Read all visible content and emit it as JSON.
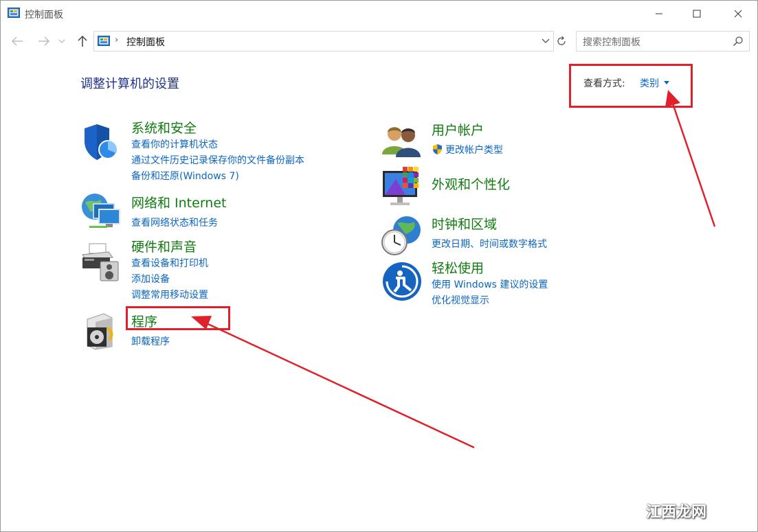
{
  "window": {
    "title": "控制面板"
  },
  "address": {
    "path": "控制面板",
    "separator": "›"
  },
  "search": {
    "placeholder": "搜索控制面板"
  },
  "main": {
    "heading": "调整计算机的设置",
    "view_by_label": "查看方式:",
    "view_by_value": "类别"
  },
  "categories": [
    {
      "title": "系统和安全",
      "links": [
        "查看你的计算机状态",
        "通过文件历史记录保存你的文件备份副本",
        "备份和还原(Windows 7)"
      ]
    },
    {
      "title": "网络和 Internet",
      "links": [
        "查看网络状态和任务"
      ]
    },
    {
      "title": "硬件和声音",
      "links": [
        "查看设备和打印机",
        "添加设备",
        "调整常用移动设置"
      ]
    },
    {
      "title": "程序",
      "links": [
        "卸载程序"
      ]
    },
    {
      "title": "用户帐户",
      "links": [
        "更改帐户类型"
      ]
    },
    {
      "title": "外观和个性化",
      "links": []
    },
    {
      "title": "时钟和区域",
      "links": [
        "更改日期、时间或数字格式"
      ]
    },
    {
      "title": "轻松使用",
      "links": [
        "使用 Windows 建议的设置",
        "优化视觉显示"
      ]
    }
  ],
  "watermark": "江西龙网",
  "colors": {
    "title_green": "#107c10",
    "link_blue": "#0b66c2",
    "heading_blue": "#1e3287",
    "annotation_red": "#e0202a"
  },
  "icons": [
    "control-panel-icon",
    "back-arrow-icon",
    "forward-arrow-icon",
    "up-arrow-icon",
    "refresh-icon",
    "search-icon",
    "shield-icon",
    "network-icon",
    "printer-icon",
    "programs-icon",
    "users-icon",
    "appearance-icon",
    "clock-globe-icon",
    "ease-of-access-icon",
    "uac-shield-icon"
  ]
}
